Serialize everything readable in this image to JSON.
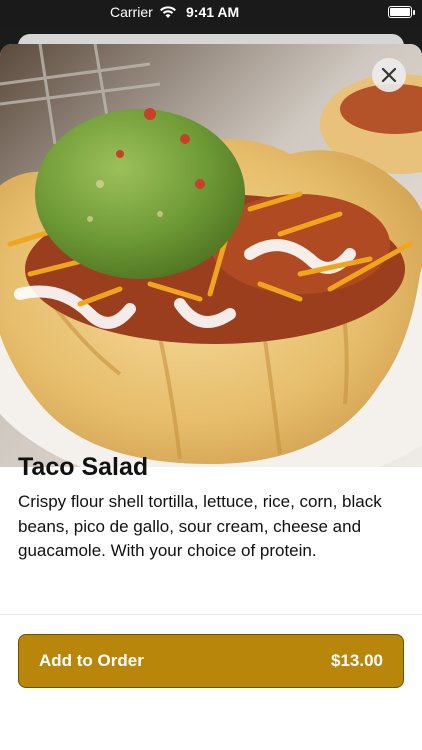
{
  "status_bar": {
    "carrier": "Carrier",
    "time": "9:41 AM",
    "wifi_icon": "wifi-icon",
    "battery_icon": "battery-icon"
  },
  "product": {
    "image_alt": "taco-salad-photo",
    "name": "Taco Salad",
    "description": "Crispy flour shell tortilla, lettuce, rice, corn, black beans, pico de gallo, sour cream, cheese and guacamole. With your choice of protein."
  },
  "actions": {
    "close_icon": "close-icon",
    "add_label": "Add to Order",
    "price": "$13.00"
  },
  "colors": {
    "accent": "#b8860b",
    "accent_border": "#6e5200"
  }
}
